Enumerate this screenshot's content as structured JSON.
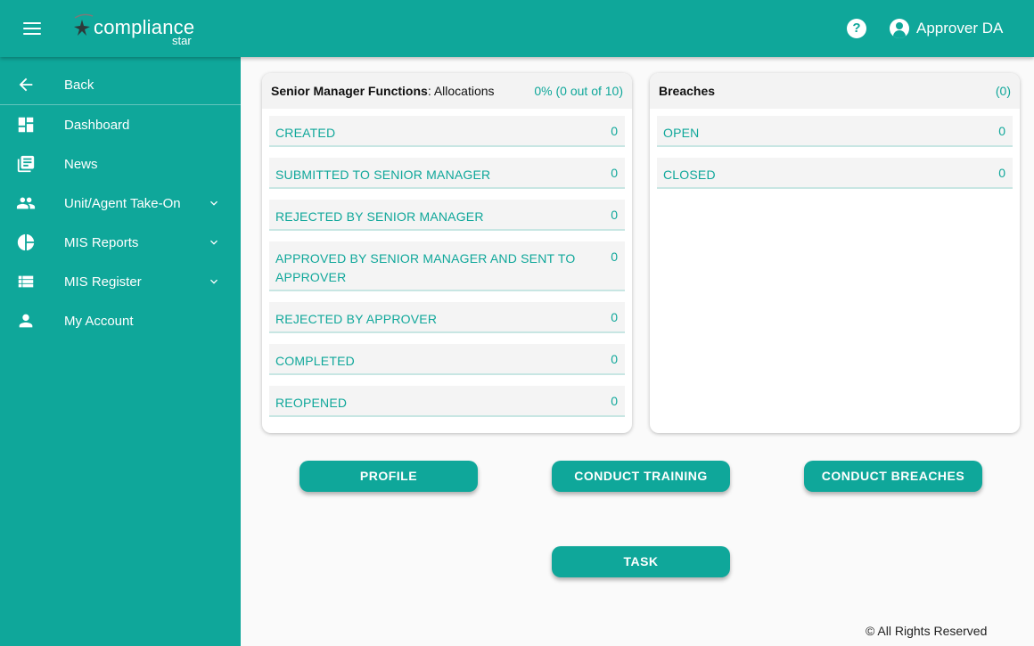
{
  "app": {
    "logo_main": "compliance",
    "logo_sub": "star",
    "user_name": "Approver DA"
  },
  "sidebar": {
    "items": [
      {
        "label": "Back",
        "icon": "arrow-left-icon"
      },
      {
        "label": "Dashboard",
        "icon": "dashboard-icon"
      },
      {
        "label": "News",
        "icon": "news-icon"
      },
      {
        "label": "Unit/Agent Take-On",
        "icon": "people-icon",
        "expandable": true
      },
      {
        "label": "MIS Reports",
        "icon": "pie-chart-icon",
        "expandable": true
      },
      {
        "label": "MIS Register",
        "icon": "list-icon",
        "expandable": true
      },
      {
        "label": "My Account",
        "icon": "person-icon"
      }
    ]
  },
  "smf_card": {
    "title_bold": "Senior Manager Functions",
    "title_rest": ": Allocations",
    "count": "0% (0 out of 10)",
    "rows": [
      {
        "label": "CREATED",
        "value": "0"
      },
      {
        "label": "SUBMITTED TO SENIOR MANAGER",
        "value": "0"
      },
      {
        "label": "REJECTED BY SENIOR MANAGER",
        "value": "0"
      },
      {
        "label": "APPROVED BY SENIOR MANAGER AND SENT TO APPROVER",
        "value": "0"
      },
      {
        "label": "REJECTED BY APPROVER",
        "value": "0"
      },
      {
        "label": "COMPLETED",
        "value": "0"
      },
      {
        "label": "REOPENED",
        "value": "0"
      }
    ]
  },
  "breaches_card": {
    "title": "Breaches",
    "count": "(0)",
    "rows": [
      {
        "label": "OPEN",
        "value": "0"
      },
      {
        "label": "CLOSED",
        "value": "0"
      }
    ]
  },
  "buttons": {
    "profile": "PROFILE",
    "conduct_training": "CONDUCT TRAINING",
    "conduct_breaches": "CONDUCT BREACHES",
    "task": "TASK"
  },
  "footer": "© All Rights Reserved",
  "colors": {
    "primary": "#0fa79a",
    "row_bg": "#f4f4f4",
    "page_bg": "#fafafa"
  }
}
